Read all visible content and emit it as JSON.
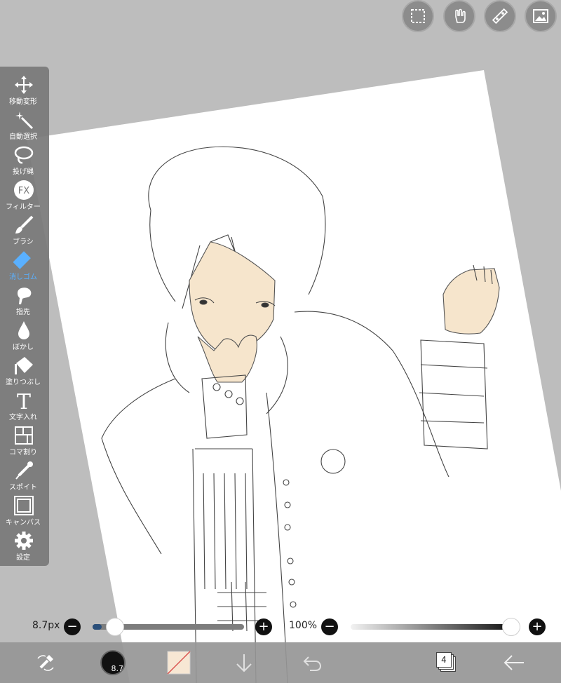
{
  "top_buttons": [
    {
      "name": "selection-icon"
    },
    {
      "name": "hand-gesture-icon"
    },
    {
      "name": "ruler-icon"
    },
    {
      "name": "image-icon"
    }
  ],
  "toolbar": {
    "items": [
      {
        "label": "移動変形",
        "icon": "move-icon"
      },
      {
        "label": "自動選択",
        "icon": "magic-wand-icon"
      },
      {
        "label": "投げ縄",
        "icon": "lasso-icon"
      },
      {
        "label": "フィルター",
        "icon": "fx-icon"
      },
      {
        "label": "ブラシ",
        "icon": "brush-icon"
      },
      {
        "label": "消しゴム",
        "icon": "eraser-icon"
      },
      {
        "label": "指先",
        "icon": "finger-icon"
      },
      {
        "label": "ぼかし",
        "icon": "blur-icon"
      },
      {
        "label": "塗りつぶし",
        "icon": "fill-icon"
      },
      {
        "label": "文字入れ",
        "icon": "text-icon"
      },
      {
        "label": "コマ割り",
        "icon": "frame-icon"
      },
      {
        "label": "スポイト",
        "icon": "eyedropper-icon"
      },
      {
        "label": "キャンバス",
        "icon": "canvas-icon"
      },
      {
        "label": "設定",
        "icon": "settings-icon"
      }
    ],
    "fx_text": "FX",
    "text_tool_glyph": "T",
    "active_index": 5
  },
  "size_slider": {
    "label": "8.7px",
    "minus": "−",
    "plus": "+",
    "fraction": 0.06
  },
  "opacity_slider": {
    "label": "100%",
    "minus": "−",
    "plus": "+",
    "fraction": 1.0
  },
  "bottom_bar": {
    "brush_size_value": "8.7",
    "layer_count": "4"
  },
  "colors": {
    "accent": "#5ab0ff",
    "secondary_color": "#f7e7d4",
    "skin": "#f6e5cc",
    "slider_track_fill": "#2a4f7a"
  }
}
